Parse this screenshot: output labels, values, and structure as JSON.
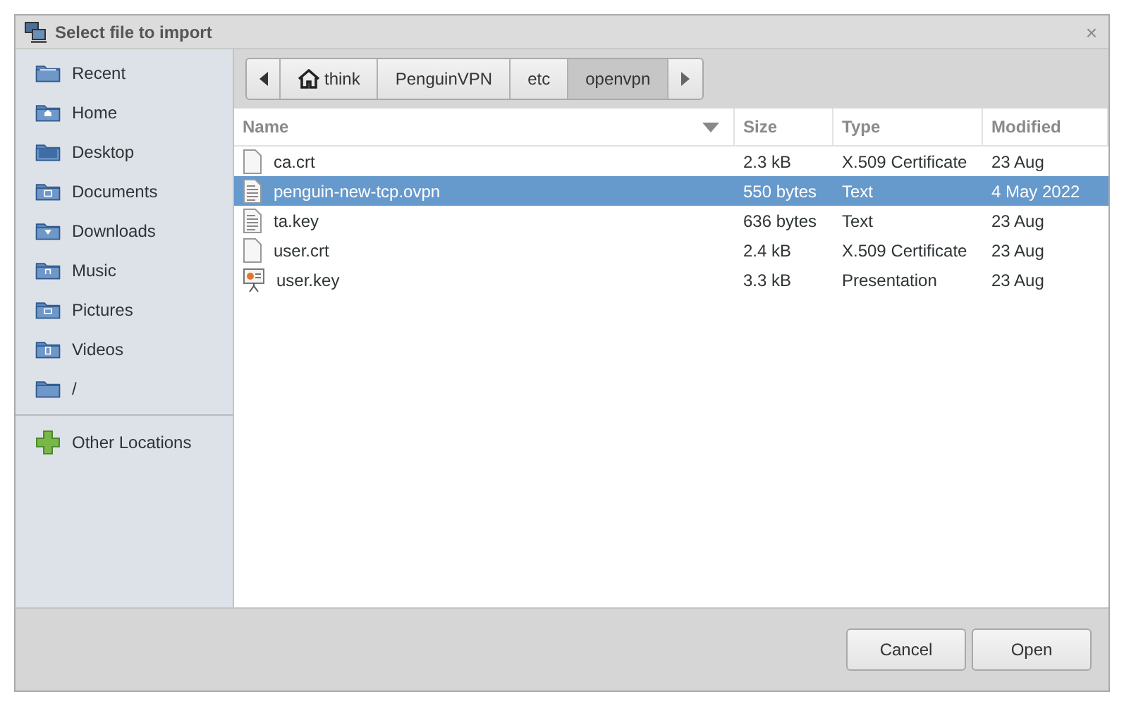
{
  "window": {
    "title": "Select file to import",
    "close": "×"
  },
  "sidebar": {
    "places": [
      {
        "label": "Recent",
        "kind": "recent"
      },
      {
        "label": "Home",
        "kind": "home"
      },
      {
        "label": "Desktop",
        "kind": "desktop"
      },
      {
        "label": "Documents",
        "kind": "documents"
      },
      {
        "label": "Downloads",
        "kind": "downloads"
      },
      {
        "label": "Music",
        "kind": "music"
      },
      {
        "label": "Pictures",
        "kind": "pictures"
      },
      {
        "label": "Videos",
        "kind": "videos"
      },
      {
        "label": "/",
        "kind": "folder"
      }
    ],
    "other": [
      {
        "label": "Other Locations",
        "kind": "plus"
      }
    ]
  },
  "path_bar": {
    "crumbs": [
      {
        "label": "think",
        "kind": "home",
        "selected": false
      },
      {
        "label": "PenguinVPN",
        "kind": "plain",
        "selected": false
      },
      {
        "label": "etc",
        "kind": "plain",
        "selected": false
      },
      {
        "label": "openvpn",
        "kind": "plain",
        "selected": true
      }
    ]
  },
  "table": {
    "columns": [
      "Name",
      "Size",
      "Type",
      "Modified"
    ],
    "rows": [
      {
        "name": "ca.crt",
        "kind": "blank",
        "size": "2.3 kB",
        "type": "X.509 Certificate",
        "modified": "23 Aug",
        "selected": false
      },
      {
        "name": "penguin-new-tcp.ovpn",
        "kind": "text",
        "size": "550 bytes",
        "type": "Text",
        "modified": "4 May 2022",
        "selected": true
      },
      {
        "name": "ta.key",
        "kind": "text",
        "size": "636 bytes",
        "type": "Text",
        "modified": "23 Aug",
        "selected": false
      },
      {
        "name": "user.crt",
        "kind": "blank",
        "size": "2.4 kB",
        "type": "X.509 Certificate",
        "modified": "23 Aug",
        "selected": false
      },
      {
        "name": "user.key",
        "kind": "presentation",
        "size": "3.3 kB",
        "type": "Presentation",
        "modified": "23 Aug",
        "selected": false
      }
    ]
  },
  "buttons": [
    "Cancel",
    "Open"
  ]
}
